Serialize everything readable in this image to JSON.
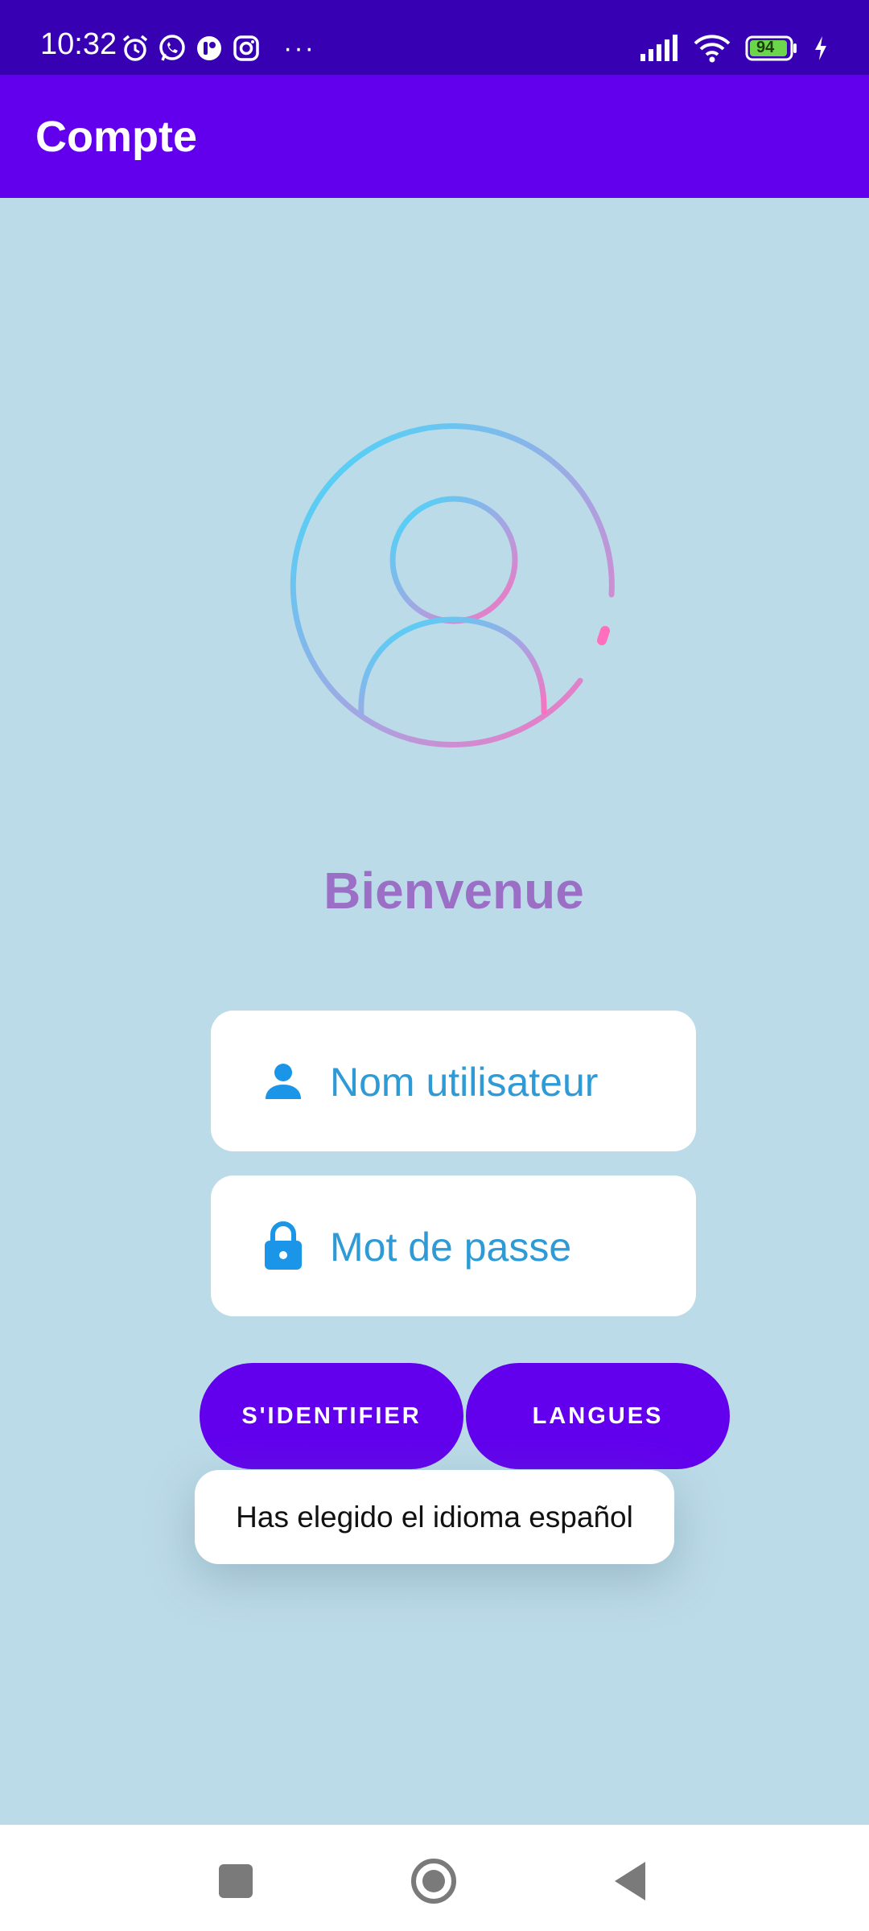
{
  "status_bar": {
    "time": "10:32",
    "battery_level": "94",
    "overflow": "···",
    "left_icons": [
      "alarm-icon",
      "whatsapp-icon",
      "app-icon",
      "instagram-icon"
    ],
    "right_icons": [
      "signal-icon",
      "wifi-icon",
      "battery-icon",
      "charging-icon"
    ]
  },
  "app_bar": {
    "title": "Compte"
  },
  "main": {
    "avatar_icon": "user-profile-icon",
    "welcome": "Bienvenue",
    "username": {
      "placeholder": "Nom utilisateur",
      "icon": "person-icon"
    },
    "password": {
      "placeholder": "Mot de passe",
      "icon": "lock-icon"
    },
    "login_button": "S'IDENTIFIER",
    "language_button": "LANGUES"
  },
  "toast": {
    "message": "Has elegido el idioma español"
  },
  "nav_bar": {
    "items": [
      "recent-apps-icon",
      "home-icon",
      "back-icon"
    ]
  },
  "colors": {
    "status_bar": "#3700b3",
    "app_bar": "#6200ee",
    "background": "#bcdbe8",
    "accent_text": "#9c6fc7",
    "field_text": "#2f9bd6",
    "field_icon": "#1b95e8",
    "avatar_gradient_start": "#3fdcfb",
    "avatar_gradient_end": "#ff6fbd"
  }
}
